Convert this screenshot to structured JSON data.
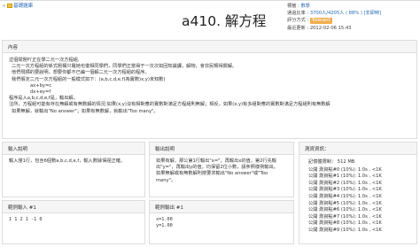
{
  "breadcrumb": {
    "arrow": "«",
    "label": "基礎題庫"
  },
  "problem": {
    "title": "a410. 解方程"
  },
  "meta": {
    "tag_label": "標籤 :",
    "tag_value": "數學",
    "pass_label": "通過比率 :",
    "pass_value": "3700人/4205人 ( 88% ) [非即時]",
    "rating_label": "評分方式 :",
    "rating_value": "Tolerant",
    "updated_label": "最近更新 :",
    "updated_value": "2012-02-06 15:43"
  },
  "content": {
    "header": "內容",
    "lines": [
      "這個問題吖正在學二元一次方程組,",
      "二元一次方程組的係式題構只羅她也復相同學們，同學們正當得于一次次如回知識課，解物，會非民類得興解。",
      "他們現標的要說明，想要你都不已編一個解二元一次方程組的程序。",
      "我們假定二元一次方程組的一般模式如下：(a,b,c,d,e,f)為實數)x,y)未知數)",
      "ax+by=c",
      "dx+ey=f",
      "程序是入a,b,c,d,e,f是，輸出解。",
      "注所，方程組可能有存在無解或有無數解的情況;如果(x,y)沒有相對應的實數對滿足方程組則無解；相反，如果(x,y)有多組對應的實數對滿足方程組則有無數解",
      "如果無解，就輸出\"No answer\"；如果有無數解，就輸出\"Too many\"。"
    ]
  },
  "input_desc": {
    "header": "輸入說明",
    "text": "輸入僅1行，包含6個數a,b,c,d,e,f，輸入數據保證正確。"
  },
  "output_desc": {
    "header": "輸出說明",
    "lines": [
      "如果有解，那公第1行輸出\"x=\"，再輸出x的值，第2行先輸出\"y=\"，再輸出y的值，均保留2位小數，請參照樣例輸出。",
      "如果無解或有無數解則按要求輸出\"No answer\"或\"Too many\"。"
    ]
  },
  "sample_in": {
    "header": "範例輸入 #1",
    "text": "1 1 2 1 -1 0"
  },
  "sample_out": {
    "header": "範例輸出 #1",
    "lines": [
      "x=1.00",
      "y=1.00"
    ]
  },
  "test": {
    "header": "測資資訊：",
    "memory": "記憶體限制： 512 MB",
    "cases": [
      "公開 測資點#0 (10%): 1.0s , <1K",
      "公開 測資點#1 (10%): 1.0s , <1K",
      "公開 測資點#2 (10%): 1.0s , <1K",
      "公開 測資點#3 (10%): 1.0s , <1K",
      "公開 測資點#4 (10%): 1.0s , <1K",
      "公開 測資點#5 (10%): 1.0s , <1K",
      "公開 測資點#6 (10%): 1.0s , <1K",
      "公開 測資點#7 (10%): 1.0s , <1K",
      "公開 測資點#8 (10%): 1.0s , <1K",
      "公開 測資點#9 (10%): 1.0s , <1K"
    ]
  }
}
